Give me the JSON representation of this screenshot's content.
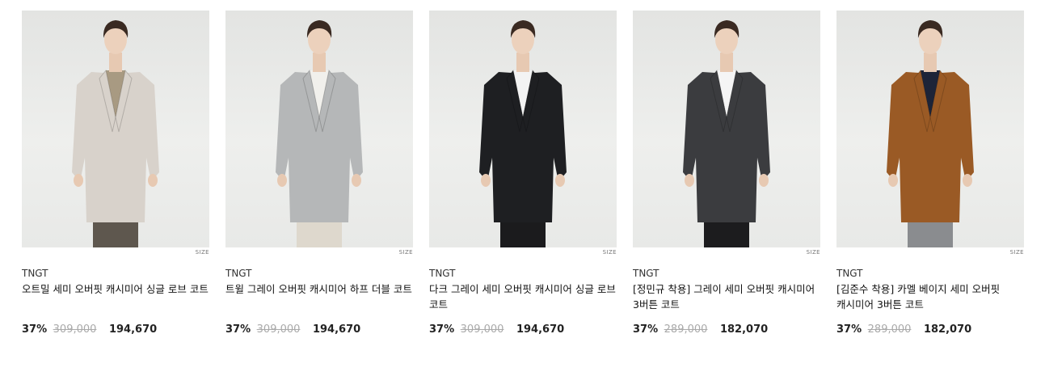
{
  "products": [
    {
      "brand": "TNGT",
      "title": "오트밀 세미 오버핏 캐시미어 싱글 로브 코트",
      "discount": "37%",
      "original_price": "309,000",
      "price": "194,670",
      "size_label": "SIZE",
      "coat_color": "#d8d2cb",
      "inner_color": "#a89a82",
      "pants_color": "#5e574e"
    },
    {
      "brand": "TNGT",
      "title": "트윌 그레이 오버핏 캐시미어 하프 더블 코트",
      "discount": "37%",
      "original_price": "309,000",
      "price": "194,670",
      "size_label": "SIZE",
      "coat_color": "#b5b7b8",
      "inner_color": "#f1f0ec",
      "pants_color": "#ded8cd"
    },
    {
      "brand": "TNGT",
      "title": "다크 그레이 세미 오버핏 캐시미어 싱글 로브 코트",
      "discount": "37%",
      "original_price": "309,000",
      "price": "194,670",
      "size_label": "SIZE",
      "coat_color": "#1e1f22",
      "inner_color": "#f3f3f3",
      "pants_color": "#1b1b1d"
    },
    {
      "brand": "TNGT",
      "title": "[정민규 착용] 그레이 세미 오버핏 캐시미어 3버튼 코트",
      "discount": "37%",
      "original_price": "289,000",
      "price": "182,070",
      "size_label": "SIZE",
      "coat_color": "#3b3c3f",
      "inner_color": "#f5f5f5",
      "pants_color": "#1c1c1e"
    },
    {
      "brand": "TNGT",
      "title": "[김준수 착용] 카멜 베이지 세미 오버핏 캐시미어 3버튼 코트",
      "discount": "37%",
      "original_price": "289,000",
      "price": "182,070",
      "size_label": "SIZE",
      "coat_color": "#9a5a25",
      "inner_color": "#1d2438",
      "pants_color": "#8a8c8f"
    }
  ]
}
